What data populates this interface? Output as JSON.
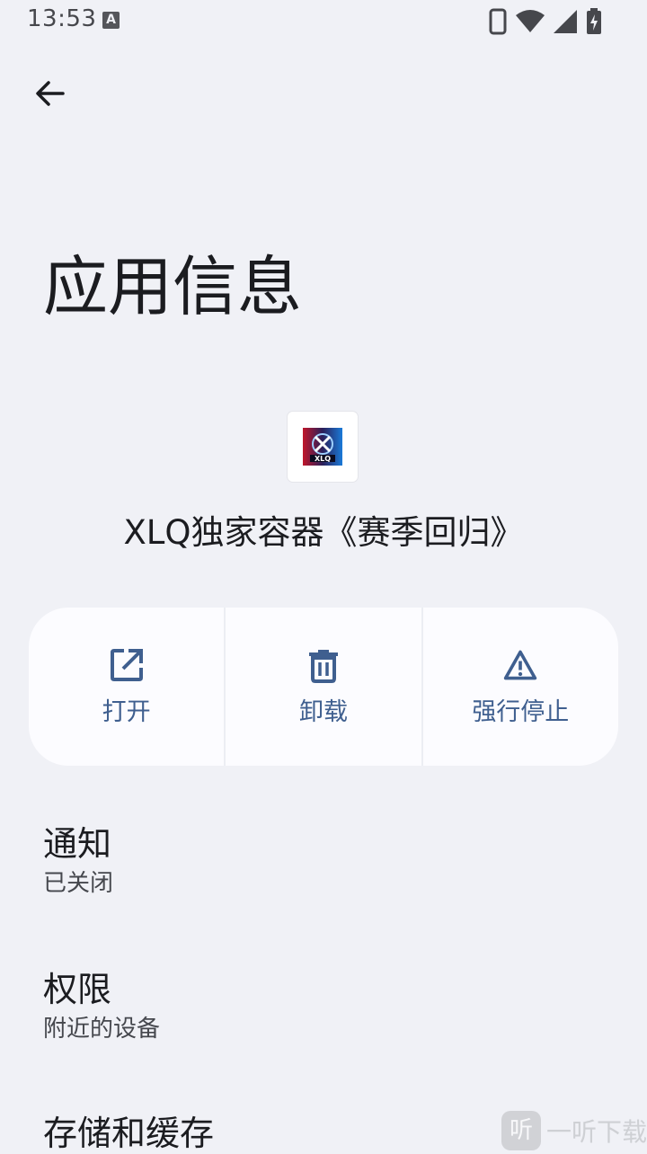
{
  "status_bar": {
    "time": "13:53",
    "notification_letter": "A",
    "icons": [
      "phone-icon",
      "wifi-icon",
      "cell-signal-icon",
      "battery-charging-icon"
    ]
  },
  "header": {
    "title": "应用信息"
  },
  "app": {
    "name": "XLQ独家容器《赛季回归》",
    "icon_text": "XLQ"
  },
  "actions": [
    {
      "label": "打开",
      "icon": "open-in-new-icon"
    },
    {
      "label": "卸载",
      "icon": "trash-icon"
    },
    {
      "label": "强行停止",
      "icon": "warning-icon"
    }
  ],
  "settings": [
    {
      "title": "通知",
      "summary": "已关闭"
    },
    {
      "title": "权限",
      "summary": "附近的设备"
    },
    {
      "title": "存储和缓存",
      "summary": ""
    }
  ],
  "watermark": {
    "logo_char": "听",
    "text": "一听下载"
  },
  "colors": {
    "background": "#f0f1f6",
    "card": "#fcfcff",
    "accent": "#3f5f8f",
    "text_primary": "#1b1c20",
    "text_secondary": "#45474d"
  }
}
